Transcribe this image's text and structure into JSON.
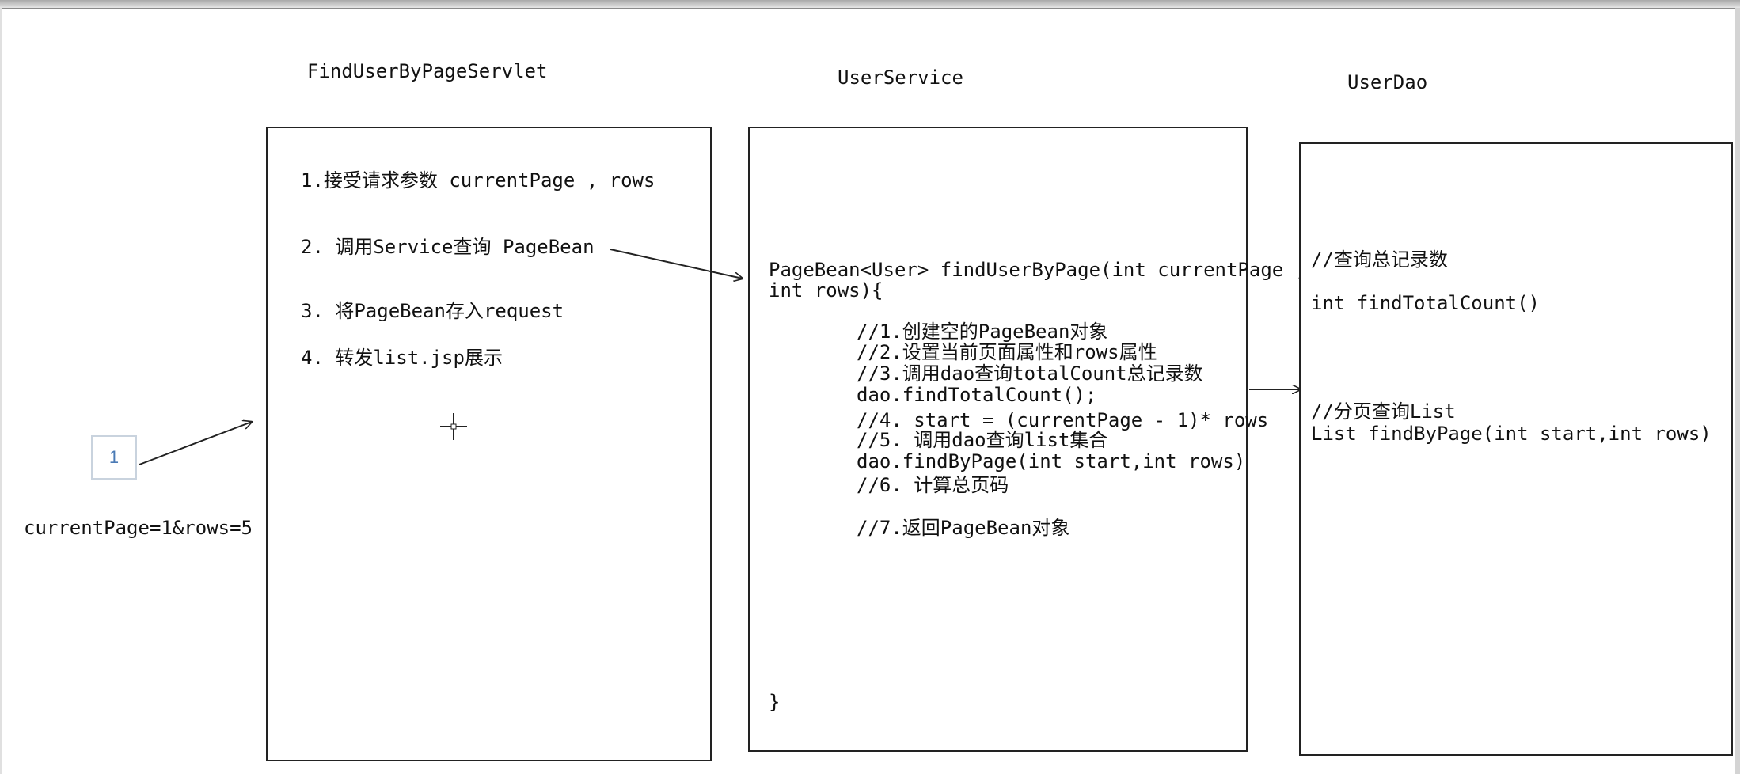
{
  "columns": {
    "servlet_title": "FindUserByPageServlet",
    "service_title": "UserService",
    "dao_title": "UserDao"
  },
  "servlet_steps": [
    "1.接受请求参数 currentPage , rows",
    "2. 调用Service查询 PageBean",
    "3. 将PageBean存入request",
    "4. 转发list.jsp展示"
  ],
  "service_code": {
    "signature_line1": "PageBean<User> findUserByPage(int currentPage ,",
    "signature_line2": "int rows){",
    "body": [
      "//1.创建空的PageBean对象",
      "//2.设置当前页面属性和rows属性",
      "//3.调用dao查询totalCount总记录数",
      "dao.findTotalCount();",
      "//4. start = (currentPage - 1)* rows",
      "//5. 调用dao查询list集合",
      "dao.findByPage(int start,int rows)",
      "//6. 计算总页码",
      "//7.返回PageBean对象"
    ],
    "closing": "}"
  },
  "dao_methods": {
    "count_comment": "//查询总记录数",
    "count_method": "int findTotalCount()",
    "page_comment": "//分页查询List",
    "page_method": "List findByPage(int start,int rows)"
  },
  "request": {
    "page_number": "1",
    "query": "currentPage=1&rows=5"
  },
  "colors": {
    "line": "#222222",
    "page_box_border": "#c9d3de",
    "page_number": "#4a7ab5"
  },
  "icons": [
    "crosshair-cursor-icon"
  ]
}
